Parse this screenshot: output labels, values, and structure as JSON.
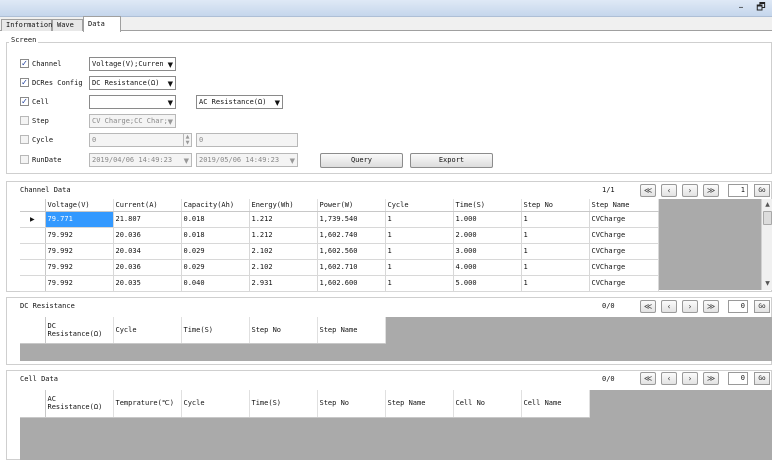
{
  "window": {
    "minimize_icon": "–",
    "restore_icon": "🗗"
  },
  "tabs": [
    {
      "label": "Information"
    },
    {
      "label": "Wave"
    },
    {
      "label": "Data"
    }
  ],
  "screen": {
    "title": "Screen",
    "channel": {
      "label": "Channel",
      "checked": true,
      "value": "Voltage(V);Curren"
    },
    "dcres": {
      "label": "DCRes Config",
      "checked": true,
      "value": "DC Resistance(Ω)"
    },
    "cell": {
      "label": "Cell",
      "checked": true,
      "value": "",
      "value2": "AC Resistance(Ω)"
    },
    "step": {
      "label": "Step",
      "checked": false,
      "value": "CV Charge;CC Char;"
    },
    "cycle": {
      "label": "Cycle",
      "checked": false,
      "from": "0",
      "to": "0"
    },
    "rundate": {
      "label": "RunDate",
      "checked": false,
      "from": "2019/04/06 14:49:23",
      "to": "2019/05/06 14:49:23"
    },
    "query_label": "Query",
    "export_label": "Export"
  },
  "channel_data": {
    "title": "Channel Data",
    "page_info": "1/1",
    "page_input": "1",
    "go_label": "Go",
    "columns": [
      "Voltage(V)",
      "Current(A)",
      "Capacity(Ah)",
      "Energy(Wh)",
      "Power(W)",
      "Cycle",
      "Time(S)",
      "Step No",
      "Step Name"
    ],
    "rows": [
      [
        "79.771",
        "21.807",
        "0.018",
        "1.212",
        "1,739.540",
        "1",
        "1.000",
        "1",
        "CVCharge"
      ],
      [
        "79.992",
        "20.036",
        "0.018",
        "1.212",
        "1,602.740",
        "1",
        "2.000",
        "1",
        "CVCharge"
      ],
      [
        "79.992",
        "20.034",
        "0.029",
        "2.102",
        "1,602.560",
        "1",
        "3.000",
        "1",
        "CVCharge"
      ],
      [
        "79.992",
        "20.036",
        "0.029",
        "2.102",
        "1,602.710",
        "1",
        "4.000",
        "1",
        "CVCharge"
      ],
      [
        "79.992",
        "20.035",
        "0.040",
        "2.931",
        "1,602.600",
        "1",
        "5.000",
        "1",
        "CVCharge"
      ]
    ]
  },
  "dc_resistance": {
    "title": "DC Resistance",
    "page_info": "0/0",
    "page_input": "0",
    "go_label": "Go",
    "columns": [
      "DC Resistance(Ω)",
      "Cycle",
      "Time(S)",
      "Step No",
      "Step Name"
    ]
  },
  "cell_data": {
    "title": "Cell Data",
    "page_info": "0/0",
    "page_input": "0",
    "go_label": "Go",
    "columns": [
      "AC Resistance(Ω)",
      "Temprature(℃)",
      "Cycle",
      "Time(S)",
      "Step No",
      "Step Name",
      "Cell No",
      "Cell Name"
    ]
  },
  "pager_icons": {
    "first": "≪",
    "prev": "‹",
    "next": "›",
    "last": "≫"
  },
  "row_pointer": "▶",
  "scroll_up": "▲",
  "scroll_down": "▼",
  "check_mark": "✓",
  "dropdown_arrow": "▼"
}
